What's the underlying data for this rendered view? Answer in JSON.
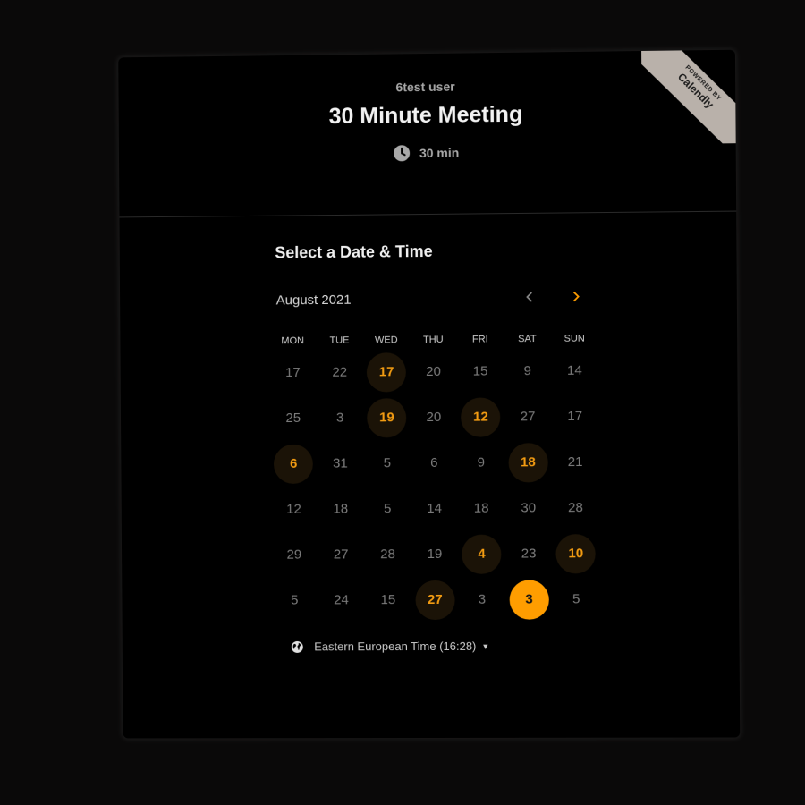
{
  "badge": {
    "powered_by": "POWERED BY",
    "brand": "Calendly"
  },
  "event": {
    "host": "6test user",
    "title": "30 Minute Meeting",
    "duration": "30 min"
  },
  "picker": {
    "heading": "Select a Date & Time",
    "month": "August 2021",
    "prev_icon": "chevron-left-icon",
    "next_icon": "chevron-right-icon",
    "weekdays": [
      "MON",
      "TUE",
      "WED",
      "THU",
      "FRI",
      "SAT",
      "SUN"
    ],
    "weeks": [
      [
        {
          "d": "17",
          "s": "disabled"
        },
        {
          "d": "22",
          "s": "disabled"
        },
        {
          "d": "17",
          "s": "available"
        },
        {
          "d": "20",
          "s": "disabled"
        },
        {
          "d": "15",
          "s": "disabled"
        },
        {
          "d": "9",
          "s": "disabled"
        },
        {
          "d": "14",
          "s": "disabled"
        }
      ],
      [
        {
          "d": "25",
          "s": "disabled"
        },
        {
          "d": "3",
          "s": "disabled"
        },
        {
          "d": "19",
          "s": "available"
        },
        {
          "d": "20",
          "s": "disabled"
        },
        {
          "d": "12",
          "s": "available"
        },
        {
          "d": "27",
          "s": "disabled"
        },
        {
          "d": "17",
          "s": "disabled"
        }
      ],
      [
        {
          "d": "6",
          "s": "available"
        },
        {
          "d": "31",
          "s": "disabled"
        },
        {
          "d": "5",
          "s": "disabled"
        },
        {
          "d": "6",
          "s": "disabled"
        },
        {
          "d": "9",
          "s": "disabled"
        },
        {
          "d": "18",
          "s": "available"
        },
        {
          "d": "21",
          "s": "disabled"
        }
      ],
      [
        {
          "d": "12",
          "s": "disabled"
        },
        {
          "d": "18",
          "s": "disabled"
        },
        {
          "d": "5",
          "s": "disabled"
        },
        {
          "d": "14",
          "s": "disabled"
        },
        {
          "d": "18",
          "s": "disabled"
        },
        {
          "d": "30",
          "s": "disabled"
        },
        {
          "d": "28",
          "s": "disabled"
        }
      ],
      [
        {
          "d": "29",
          "s": "disabled"
        },
        {
          "d": "27",
          "s": "disabled"
        },
        {
          "d": "28",
          "s": "disabled"
        },
        {
          "d": "19",
          "s": "disabled"
        },
        {
          "d": "4",
          "s": "available"
        },
        {
          "d": "23",
          "s": "disabled"
        },
        {
          "d": "10",
          "s": "available"
        }
      ],
      [
        {
          "d": "5",
          "s": "disabled"
        },
        {
          "d": "24",
          "s": "disabled"
        },
        {
          "d": "15",
          "s": "disabled"
        },
        {
          "d": "27",
          "s": "available"
        },
        {
          "d": "3",
          "s": "disabled"
        },
        {
          "d": "3",
          "s": "selected"
        },
        {
          "d": "5",
          "s": "disabled"
        }
      ]
    ]
  },
  "timezone": {
    "label": "Eastern European Time (16:28)",
    "icon": "globe-icon"
  },
  "colors": {
    "accent": "#ff9d00",
    "available_text": "#f39c12",
    "available_bg": "#1b1307",
    "card_bg": "#000000",
    "page_bg": "#0a0909",
    "ribbon": "#b9b1aa"
  }
}
